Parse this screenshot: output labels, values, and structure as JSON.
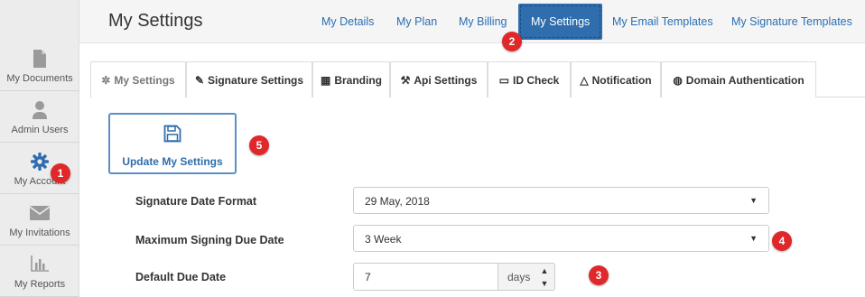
{
  "sidebar": {
    "items": [
      {
        "label": "My Documents",
        "icon": "document-icon"
      },
      {
        "label": "Admin Users",
        "icon": "user-icon"
      },
      {
        "label": "My Account",
        "icon": "gear-icon"
      },
      {
        "label": "My Invitations",
        "icon": "envelope-icon"
      },
      {
        "label": "My Reports",
        "icon": "bar-chart-icon"
      }
    ]
  },
  "header": {
    "title": "My Settings",
    "nav": [
      {
        "label": "My Details"
      },
      {
        "label": "My Plan"
      },
      {
        "label": "My Billing"
      },
      {
        "label": "My Settings",
        "active": true
      },
      {
        "label": "My Email Templates"
      },
      {
        "label": "My Signature Templates"
      }
    ]
  },
  "tabs": [
    {
      "label": "My Settings",
      "icon": "gear-icon",
      "active": true
    },
    {
      "label": "Signature Settings",
      "icon": "pencil-icon"
    },
    {
      "label": "Branding",
      "icon": "grid-icon"
    },
    {
      "label": "Api Settings",
      "icon": "wrench-icon"
    },
    {
      "label": "ID Check",
      "icon": "id-card-icon"
    },
    {
      "label": "Notification",
      "icon": "bell-icon"
    },
    {
      "label": "Domain Authentication",
      "icon": "globe-icon"
    }
  ],
  "form": {
    "update_label": "Update My Settings",
    "signature_date_format": {
      "label": "Signature Date Format",
      "value": "29 May, 2018"
    },
    "max_signing_due_date": {
      "label": "Maximum Signing Due Date",
      "value": "3 Week"
    },
    "default_due_date": {
      "label": "Default Due Date",
      "value": "7",
      "unit": "days"
    }
  },
  "annotations": [
    "1",
    "2",
    "3",
    "4",
    "5"
  ],
  "colors": {
    "accent": "#2f6dad",
    "badge": "#e0282a",
    "link": "#2a6fb4"
  }
}
